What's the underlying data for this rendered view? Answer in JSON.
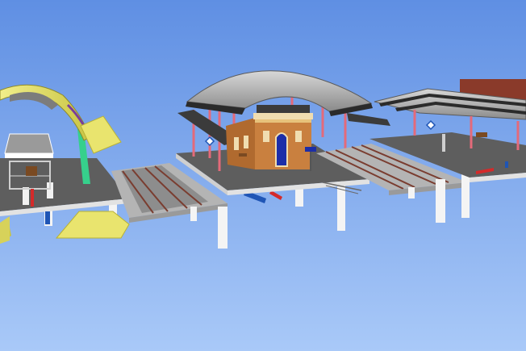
{
  "scene": {
    "description_visible_text": "",
    "colors": {
      "sky_top": "#5f8fe3",
      "sky_bottom": "#a7c8f8",
      "platform_top": "#5e5e5e",
      "platform_side": "#e0e0e0",
      "pillar": "#f4f4f4",
      "track_bed": "#b4b4b4",
      "rail": "#7a3d30",
      "roof_silver": "#a9a9a9",
      "roof_dark": "#2b2b2b",
      "canopy_yellow": "#e9e46e",
      "canopy_green": "#36d08c",
      "frame_pink": "#e46a7a",
      "brick": "#c9803f",
      "trim_cream": "#f0ddb0",
      "door_blue": "#1d2ea8",
      "accent_red": "#d42a2a",
      "accent_blue": "#1f55b5"
    }
  }
}
